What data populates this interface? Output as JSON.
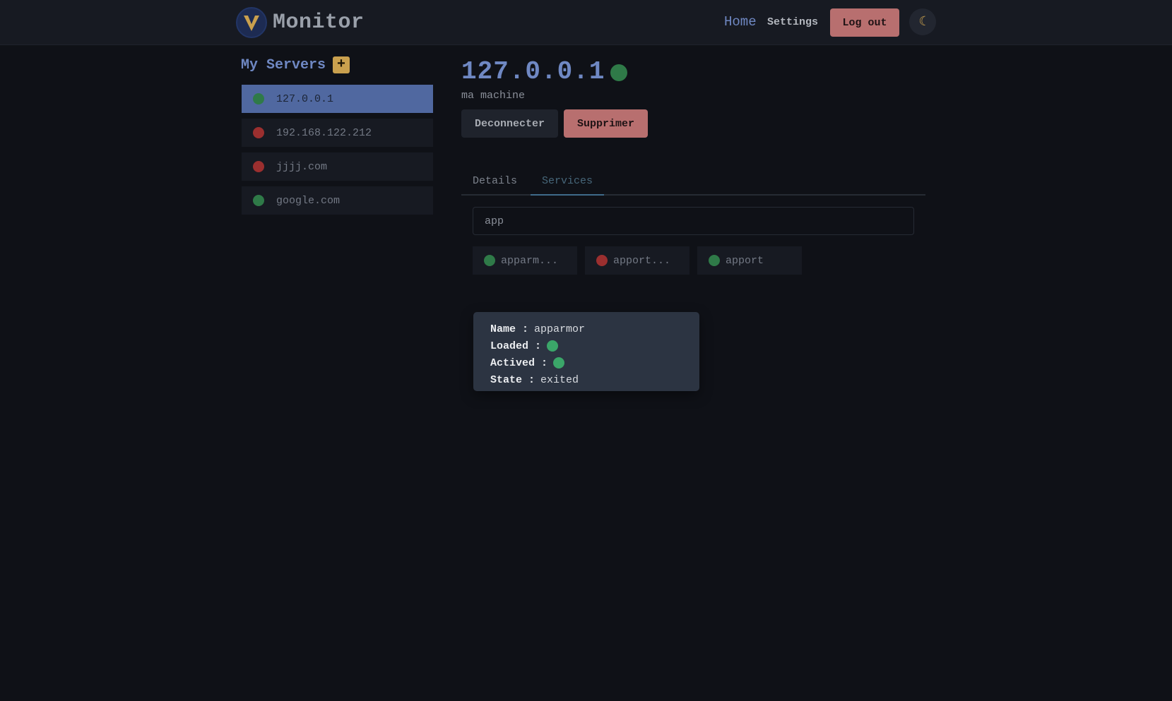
{
  "app": {
    "title": "Monitor"
  },
  "nav": {
    "home": "Home",
    "settings": "Settings",
    "logout": "Log out",
    "theme_icon": "moon-icon"
  },
  "sidebar": {
    "title": "My Servers",
    "add_label": "+",
    "servers": [
      {
        "name": "127.0.0.1",
        "status": "online",
        "selected": true
      },
      {
        "name": "192.168.122.212",
        "status": "offline",
        "selected": false
      },
      {
        "name": "jjjj.com",
        "status": "offline",
        "selected": false
      },
      {
        "name": "google.com",
        "status": "online",
        "selected": false
      }
    ]
  },
  "server": {
    "host": "127.0.0.1",
    "status": "online",
    "description": "ma machine",
    "disconnect_label": "Deconnecter",
    "delete_label": "Supprimer"
  },
  "tabs": [
    {
      "label": "Details",
      "active": false
    },
    {
      "label": "Services",
      "active": true
    }
  ],
  "search": {
    "value": "app",
    "placeholder": ""
  },
  "services": [
    {
      "label": "apparm...",
      "status": "active"
    },
    {
      "label": "apport...",
      "status": "inactive"
    },
    {
      "label": "apport",
      "status": "active"
    }
  ],
  "tooltip": {
    "name_key": "Name :",
    "name_value": "apparmor",
    "loaded_key": "Loaded :",
    "loaded": true,
    "actived_key": "Actived :",
    "actived": true,
    "state_key": "State :",
    "state_value": "exited"
  },
  "colors": {
    "background": "#0f1117",
    "accent": "#6f88c3",
    "danger": "#b86f6f",
    "online": "#2f7a48",
    "offline": "#9b2f2f",
    "warning": "#c9a04e"
  }
}
